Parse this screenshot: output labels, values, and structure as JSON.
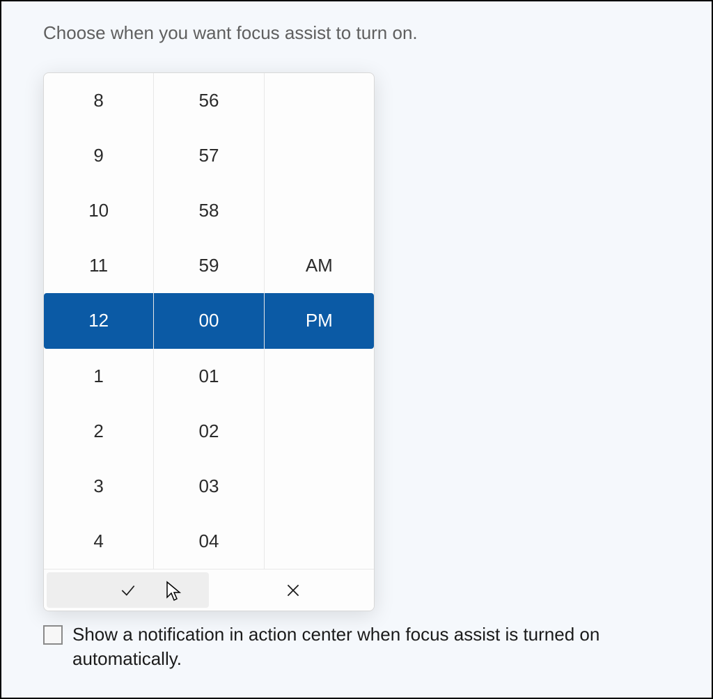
{
  "heading": "Choose when you want focus assist to turn on.",
  "picker": {
    "hours": [
      "8",
      "9",
      "10",
      "11",
      "12",
      "1",
      "2",
      "3",
      "4"
    ],
    "minutes": [
      "56",
      "57",
      "58",
      "59",
      "00",
      "01",
      "02",
      "03",
      "04"
    ],
    "meridiem": [
      "",
      "",
      "",
      "AM",
      "PM",
      "",
      "",
      "",
      ""
    ],
    "selected_index": 4
  },
  "checkbox": {
    "checked": false,
    "label": "Show a notification in action center when focus assist is turned on automatically."
  }
}
